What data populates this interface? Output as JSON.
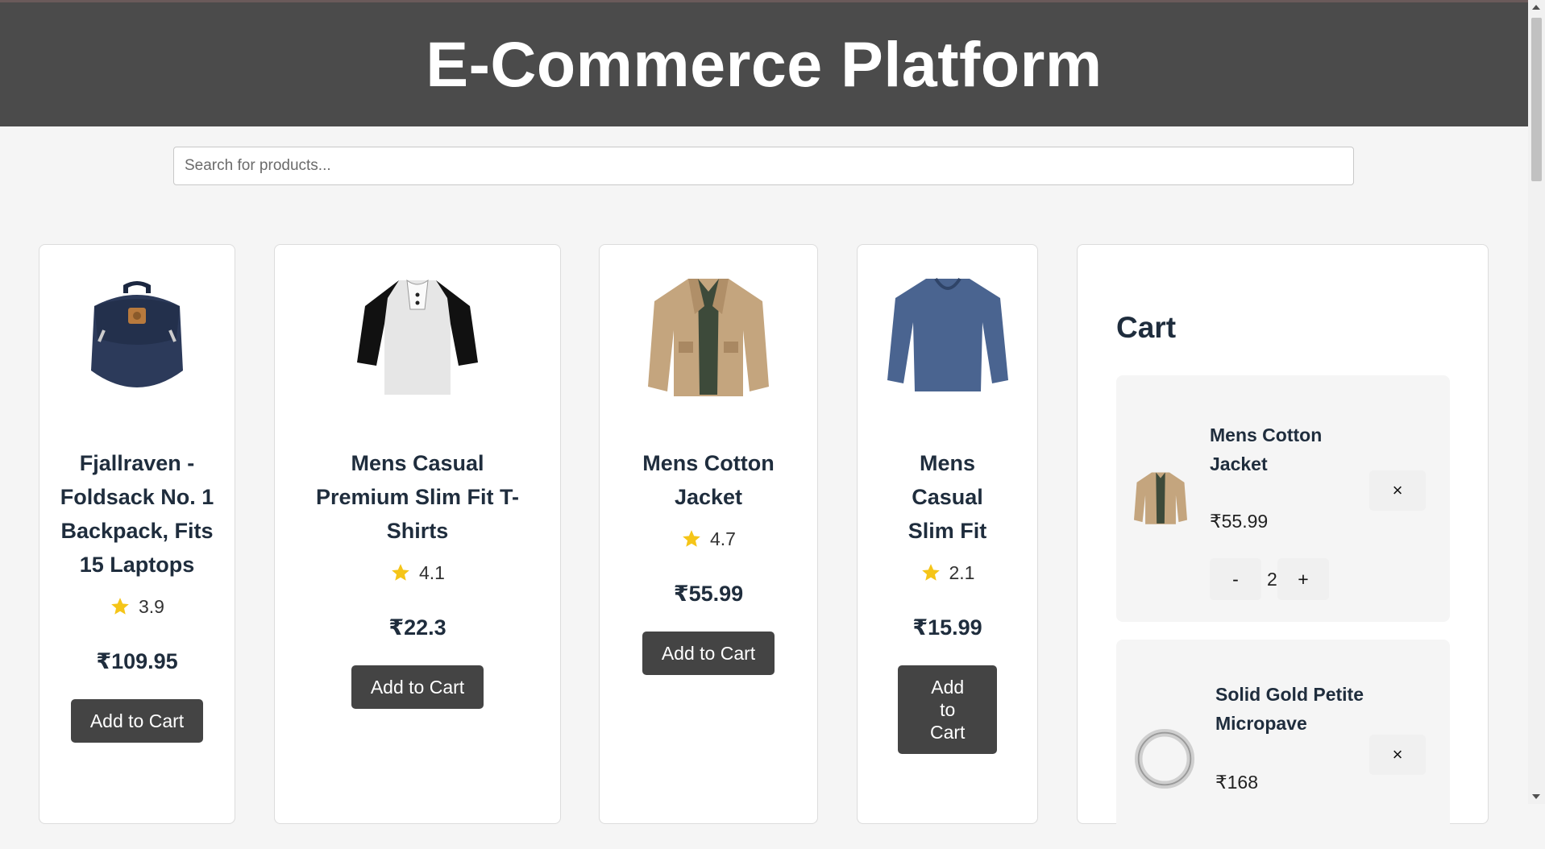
{
  "header": {
    "title": "E-Commerce Platform"
  },
  "search": {
    "placeholder": "Search for products..."
  },
  "products": [
    {
      "name": "Fjallraven - Foldsack No. 1 Backpack, Fits 15 Laptops",
      "rating": "3.9",
      "price": "₹109.95",
      "button": "Add to Cart",
      "image_icon": "backpack-icon"
    },
    {
      "name": "Mens Casual Premium Slim Fit T-Shirts",
      "rating": "4.1",
      "price": "₹22.3",
      "button": "Add to Cart",
      "image_icon": "tshirt-icon"
    },
    {
      "name": "Mens Cotton Jacket",
      "rating": "4.7",
      "price": "₹55.99",
      "button": "Add to Cart",
      "image_icon": "jacket-icon"
    },
    {
      "name": "Mens Casual Slim Fit",
      "rating": "2.1",
      "price": "₹15.99",
      "button": "Add to Cart",
      "image_icon": "longsleeve-icon"
    }
  ],
  "cart": {
    "title": "Cart",
    "items": [
      {
        "name": "Mens Cotton Jacket",
        "price": "₹55.99",
        "quantity": "2",
        "remove_label": "×",
        "minus_label": "-",
        "plus_label": "+"
      },
      {
        "name": "Solid Gold Petite Micropave",
        "price": "₹168",
        "remove_label": "×"
      }
    ]
  },
  "colors": {
    "header_bg": "#4b4b4b",
    "button_bg": "#444444",
    "star": "#f5c518",
    "text": "#1f2d3d"
  }
}
